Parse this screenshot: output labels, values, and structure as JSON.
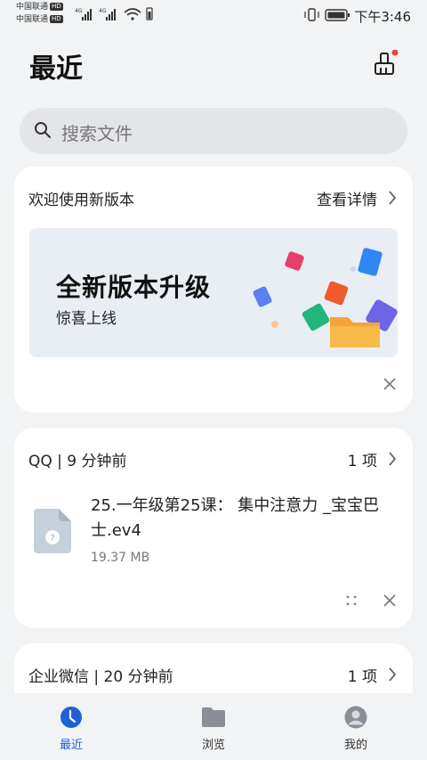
{
  "status_bar": {
    "carrier1": "中国联通",
    "carrier2": "中国联通",
    "hd": "HD",
    "signal": "4G",
    "time": "下午3:46"
  },
  "header": {
    "title": "最近",
    "cleaner_icon": "broom-icon"
  },
  "search": {
    "placeholder": "搜索文件"
  },
  "welcome_card": {
    "title": "欢迎使用新版本",
    "link": "查看详情",
    "banner_title": "全新版本升级",
    "banner_subtitle": "惊喜上线"
  },
  "qq_card": {
    "title": "QQ | 9 分钟前",
    "count": "1 项",
    "file_name": "25.一年级第25课：   集中注意力 _宝宝巴士.ev4",
    "file_size": "19.37 MB"
  },
  "wechat_card": {
    "title": "企业微信 | 20 分钟前",
    "count": "1 项"
  },
  "bottom_nav": {
    "items": [
      {
        "label": "最近",
        "icon": "clock-icon",
        "active": true
      },
      {
        "label": "浏览",
        "icon": "folder-icon",
        "active": false
      },
      {
        "label": "我的",
        "icon": "profile-icon",
        "active": false
      }
    ]
  },
  "colors": {
    "accent": "#1f5fd9",
    "background": "#f1f3f5",
    "card": "#ffffff"
  }
}
